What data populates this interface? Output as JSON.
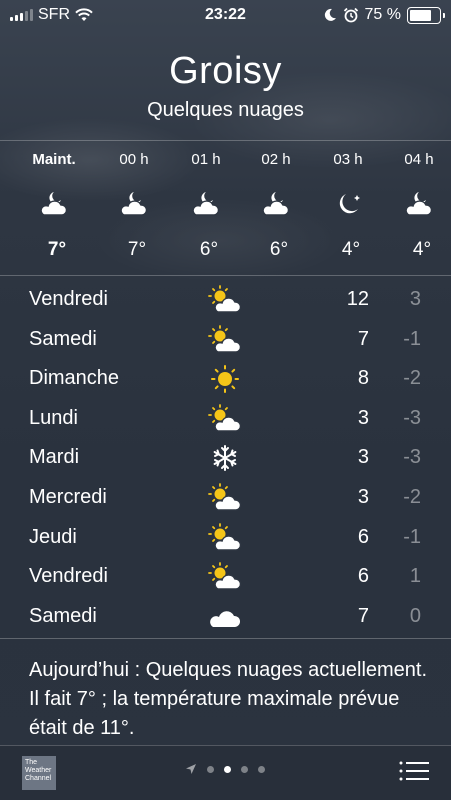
{
  "status_bar": {
    "carrier": "SFR",
    "time": "23:22",
    "battery": "75 %",
    "battery_level": 0.75
  },
  "header": {
    "city": "Groisy",
    "condition": "Quelques nuages"
  },
  "hourly": [
    {
      "label": "Maint.",
      "icon": "partly-cloudy-night-icon",
      "temp": "7°"
    },
    {
      "label": "00 h",
      "icon": "partly-cloudy-night-icon",
      "temp": "7°"
    },
    {
      "label": "01 h",
      "icon": "partly-cloudy-night-icon",
      "temp": "6°"
    },
    {
      "label": "02 h",
      "icon": "partly-cloudy-night-icon",
      "temp": "6°"
    },
    {
      "label": "03 h",
      "icon": "clear-night-icon",
      "temp": "4°"
    },
    {
      "label": "04 h",
      "icon": "partly-cloudy-night-icon",
      "temp": "4°"
    }
  ],
  "daily": [
    {
      "day": "Vendredi",
      "icon": "partly-sunny-icon",
      "high": "12",
      "low": "3"
    },
    {
      "day": "Samedi",
      "icon": "partly-sunny-icon",
      "high": "7",
      "low": "-1"
    },
    {
      "day": "Dimanche",
      "icon": "sunny-icon",
      "high": "8",
      "low": "-2"
    },
    {
      "day": "Lundi",
      "icon": "partly-sunny-icon",
      "high": "3",
      "low": "-3"
    },
    {
      "day": "Mardi",
      "icon": "snowflake-icon",
      "high": "3",
      "low": "-3"
    },
    {
      "day": "Mercredi",
      "icon": "partly-sunny-icon",
      "high": "3",
      "low": "-2"
    },
    {
      "day": "Jeudi",
      "icon": "partly-sunny-icon",
      "high": "6",
      "low": "-1"
    },
    {
      "day": "Vendredi",
      "icon": "partly-sunny-icon",
      "high": "6",
      "low": "1"
    },
    {
      "day": "Samedi",
      "icon": "cloudy-icon",
      "high": "7",
      "low": "0"
    }
  ],
  "summary": "Aujourd’hui : Quelques nuages actuellement. Il fait 7° ; la température maximale prévue était de 11°.",
  "bottom_bar": {
    "logo_text": "The Weather Channel",
    "page_count": 4,
    "current_page": 2
  },
  "colors": {
    "background": "#2e3642",
    "sun": "#f5c518",
    "muted_text": "#8a9099"
  }
}
